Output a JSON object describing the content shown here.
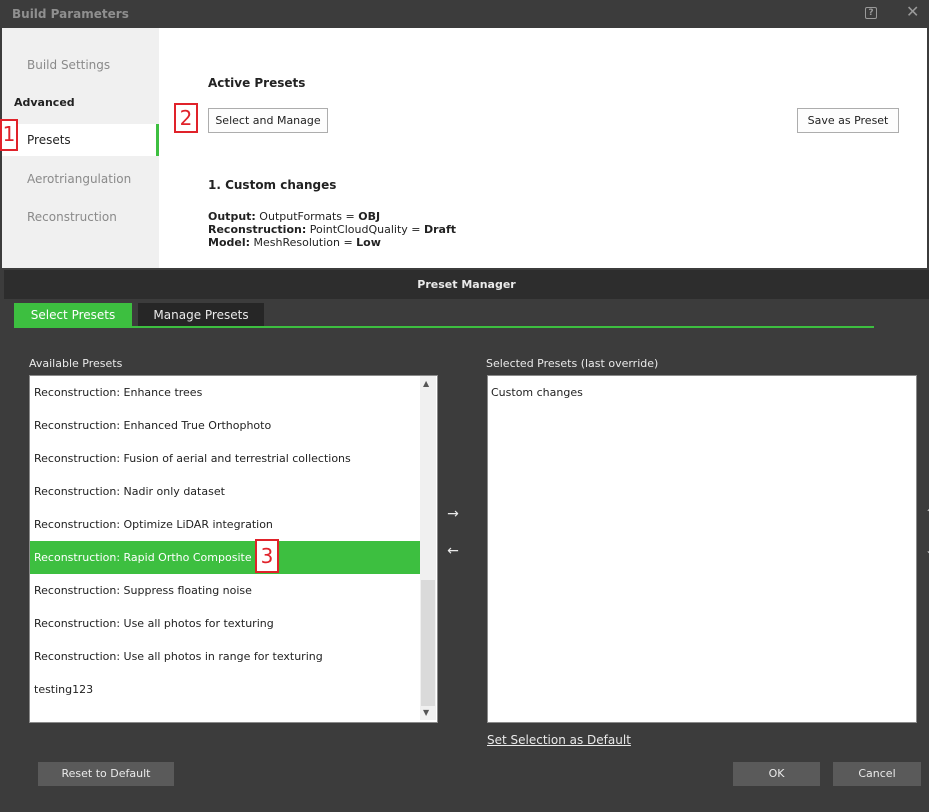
{
  "window": {
    "title": "Build Parameters",
    "help_icon": "?",
    "close_icon": "✕"
  },
  "sidebar": {
    "build_settings": "Build Settings",
    "section_header": "Advanced",
    "items": [
      {
        "label": "Presets",
        "active": true
      },
      {
        "label": "Aerotriangulation"
      },
      {
        "label": "Reconstruction"
      }
    ]
  },
  "markers": [
    "1",
    "2",
    "3"
  ],
  "content": {
    "title": "Active Presets",
    "select_manage_label": "Select and Manage",
    "save_preset_label": "Save as Preset",
    "custom_changes_title": "1.  Custom changes",
    "changes": [
      {
        "key": "Output:",
        "param": " OutputFormats = ",
        "value": "OBJ"
      },
      {
        "key": "Reconstruction:",
        "param": " PointCloudQuality = ",
        "value": "Draft"
      },
      {
        "key": "Model:",
        "param": " MeshResolution = ",
        "value": "Low"
      }
    ]
  },
  "preset_manager": {
    "title": "Preset Manager",
    "tabs": [
      "Select Presets",
      "Manage Presets"
    ],
    "available_label": "Available Presets",
    "selected_label": "Selected Presets (last override)",
    "available": [
      "Reconstruction: Enhance trees",
      "Reconstruction: Enhanced True Orthophoto",
      "Reconstruction: Fusion of aerial and terrestrial collections",
      "Reconstruction: Nadir only dataset",
      "Reconstruction: Optimize LiDAR integration",
      "Reconstruction: Rapid Ortho Composite",
      "Reconstruction: Suppress floating noise",
      "Reconstruction: Use all photos for texturing",
      "Reconstruction: Use all photos in range for texturing",
      "testing123"
    ],
    "selected_index": 5,
    "selected": [
      "Custom changes"
    ],
    "add_arrow": "→",
    "remove_arrow": "←",
    "set_default_link": "Set Selection as Default",
    "reset_label": "Reset to Default",
    "ok_label": "OK",
    "cancel_label": "Cancel"
  },
  "colors": {
    "accent": "#3dbf40",
    "marker": "#e0222a",
    "dark_bg": "#3c3c3c"
  }
}
